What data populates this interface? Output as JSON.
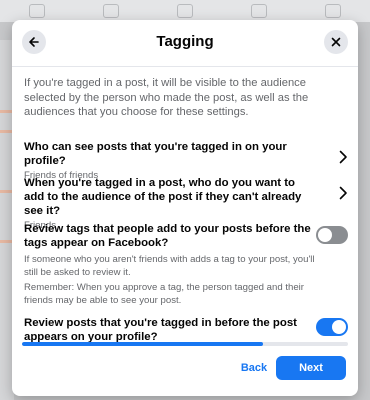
{
  "colors": {
    "accent": "#1877f2",
    "toggle_off": "#8a8d91",
    "toggle_on": "#1877f2"
  },
  "header": {
    "title": "Tagging",
    "back_icon": "arrow-left-icon",
    "close_icon": "close-icon"
  },
  "intro": "If you're tagged in a post, it will be visible to the audience selected by the person who made the post, as well as the audiences that you choose for these settings.",
  "settings": [
    {
      "title": "Who can see posts that you're tagged in on your profile?",
      "value": "Friends of friends",
      "icon": "chevron-right-icon"
    },
    {
      "title": "When you're tagged in a post, who do you want to add to the audience of the post if they can't already see it?",
      "value": "Friends",
      "icon": "chevron-right-icon"
    }
  ],
  "review_tags": {
    "title": "Review tags that people add to your posts before the tags appear on Facebook?",
    "desc1": "If someone who you aren't friends with adds a tag to your post, you'll still be asked to review it.",
    "desc2": "Remember: When you approve a tag, the person tagged and their friends may be able to see your post.",
    "enabled": false
  },
  "review_posts": {
    "title": "Review posts that you're tagged in before the post appears on your profile?",
    "enabled": true
  },
  "progress": 0.74,
  "footer": {
    "back_label": "Back",
    "next_label": "Next"
  }
}
